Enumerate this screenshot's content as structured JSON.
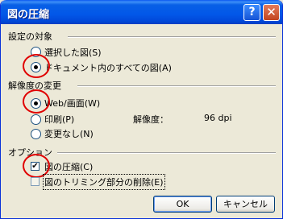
{
  "window": {
    "title": "図の圧縮",
    "help_glyph": "?",
    "close_glyph": "✕"
  },
  "target_group": {
    "title": "設定の対象",
    "options": [
      {
        "label": "選択した図(S)",
        "selected": false
      },
      {
        "label": "ドキュメント内のすべての図(A)",
        "selected": true
      }
    ]
  },
  "resolution_group": {
    "title": "解像度の変更",
    "options": [
      {
        "label": "Web/画面(W)",
        "selected": true
      },
      {
        "label": "印刷(P)",
        "selected": false
      },
      {
        "label": "変更なし(N)",
        "selected": false
      }
    ],
    "resolution_label": "解像度：",
    "resolution_value": "96 dpi"
  },
  "options_group": {
    "title": "オプション",
    "compress_label": "図の圧縮(C)",
    "compress_checked": true,
    "crop_label": "図のトリミング部分の削除(E)",
    "crop_checked": false
  },
  "buttons": {
    "ok": "OK",
    "cancel": "キャンセル"
  },
  "highlight_color": "#E00000"
}
